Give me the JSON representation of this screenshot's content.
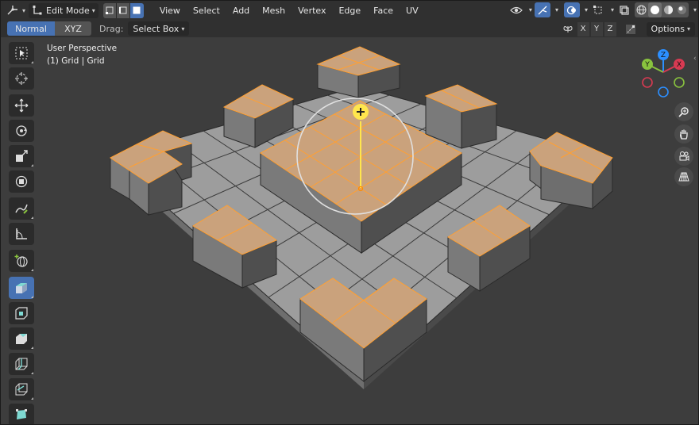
{
  "header": {
    "mode": "Edit Mode",
    "menus": [
      "View",
      "Select",
      "Add",
      "Mesh",
      "Vertex",
      "Edge",
      "Face",
      "UV"
    ]
  },
  "tool_settings": {
    "orientation_options": [
      "Normal",
      "XYZ"
    ],
    "drag_label": "Drag:",
    "drag_value": "Select Box",
    "axes": [
      "X",
      "Y",
      "Z"
    ],
    "options_label": "Options"
  },
  "viewport": {
    "view_name": "User Perspective",
    "object_info": "(1) Grid | Grid"
  },
  "gizmo": {
    "axes": [
      "X",
      "Y",
      "Z"
    ],
    "colors": {
      "x": "#d83a52",
      "y": "#89c33e",
      "z": "#2c8fff"
    }
  },
  "tools": [
    "select-box-icon",
    "cursor-icon",
    "move-icon",
    "rotate-icon",
    "scale-icon",
    "transform-icon",
    "annotate-icon",
    "measure-icon",
    "add-cube-icon",
    "extrude-icon",
    "inset-icon",
    "bevel-icon",
    "loop-cut-icon",
    "knife-icon",
    "poly-build-icon"
  ],
  "colors": {
    "accent": "#4772b3",
    "selected_face": "#ffa033",
    "face": "#9b9b9b"
  }
}
